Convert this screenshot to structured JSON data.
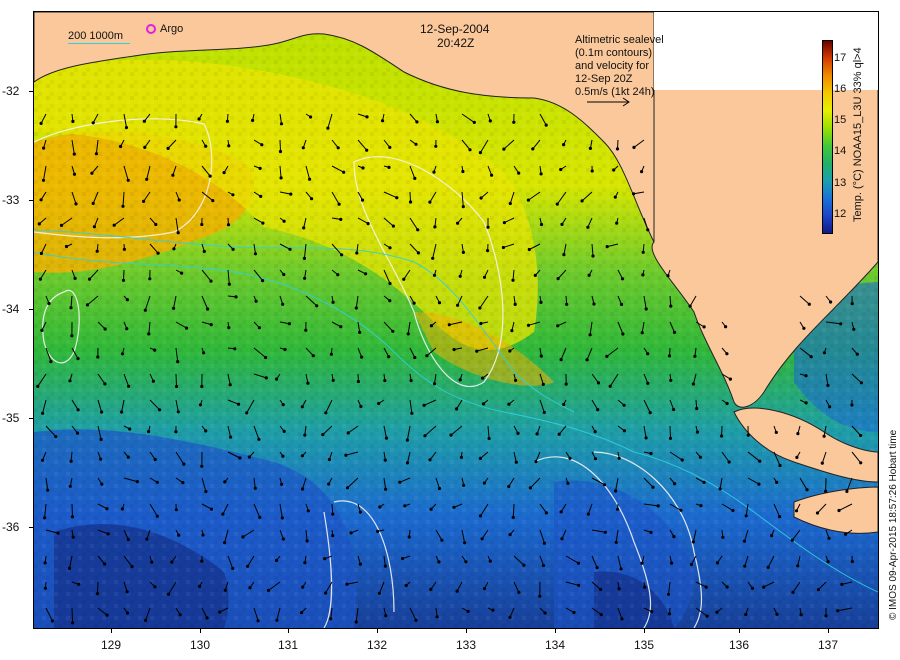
{
  "header": {
    "date": "12-Sep-2004",
    "time": "20:42Z"
  },
  "legend": {
    "contour_depths": "200  1000m",
    "argo_label": "Argo"
  },
  "altimetry_note": {
    "lines": [
      "Altimetric sealevel",
      "(0.1m contours)",
      "and velocity for",
      "12-Sep 20Z",
      "0.5m/s (1kt 24h)"
    ]
  },
  "colorbar": {
    "title": "Temp. (°C) NOAA15_L3U 33% ql>4",
    "ticks": [
      "17",
      "16",
      "15",
      "14",
      "13",
      "12"
    ],
    "colors": [
      "#6a0000",
      "#d43b00",
      "#f08a00",
      "#f2c800",
      "#e8f000",
      "#9ee000",
      "#3fc83a",
      "#22b06a",
      "#1aa0b0",
      "#1a72d8",
      "#1c44c8",
      "#121a8a"
    ]
  },
  "axes": {
    "y_ticks": [
      "-32",
      "-33",
      "-34",
      "-35",
      "-36"
    ],
    "x_ticks": [
      "129",
      "130",
      "131",
      "132",
      "133",
      "134",
      "135",
      "136",
      "137"
    ]
  },
  "credit": "© IMOS 09-Apr-2015 18:57:26 Hobart time",
  "map_colors": {
    "land": "#fac89a",
    "warm": "#f0b400",
    "yellow": "#e6ea00",
    "green": "#30b83a",
    "cool": "#1aa0a8",
    "blue": "#1c6ad0",
    "deep": "#14308a"
  }
}
